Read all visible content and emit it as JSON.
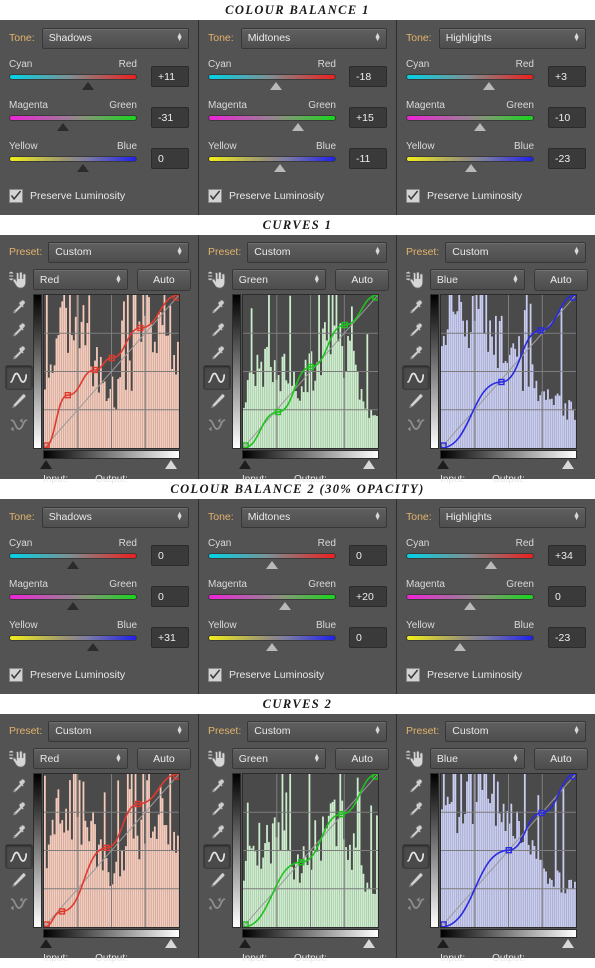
{
  "sections": [
    {
      "id": "colour-balance-1",
      "title": "COLOUR BALANCE 1",
      "type": "colour-balance",
      "panels": [
        {
          "tone_label": "Tone:",
          "tone_value": "Shadows",
          "thumb_style": "dark",
          "sliders": [
            {
              "left": "Cyan",
              "right": "Red",
              "value": "+11",
              "pos": 62
            },
            {
              "left": "Magenta",
              "right": "Green",
              "value": "-31",
              "pos": 42
            },
            {
              "left": "Yellow",
              "right": "Blue",
              "value": "0",
              "pos": 58
            }
          ],
          "preserve_label": "Preserve Luminosity",
          "preserve_checked": true
        },
        {
          "tone_label": "Tone:",
          "tone_value": "Midtones",
          "thumb_style": "light",
          "sliders": [
            {
              "left": "Cyan",
              "right": "Red",
              "value": "-18",
              "pos": 53
            },
            {
              "left": "Magenta",
              "right": "Green",
              "value": "+15",
              "pos": 71
            },
            {
              "left": "Yellow",
              "right": "Blue",
              "value": "-11",
              "pos": 56
            }
          ],
          "preserve_label": "Preserve Luminosity",
          "preserve_checked": true
        },
        {
          "tone_label": "Tone:",
          "tone_value": "Highlights",
          "thumb_style": "light",
          "sliders": [
            {
              "left": "Cyan",
              "right": "Red",
              "value": "+3",
              "pos": 65
            },
            {
              "left": "Magenta",
              "right": "Green",
              "value": "-10",
              "pos": 58
            },
            {
              "left": "Yellow",
              "right": "Blue",
              "value": "-23",
              "pos": 51
            }
          ],
          "preserve_label": "Preserve Luminosity",
          "preserve_checked": true
        }
      ]
    },
    {
      "id": "curves-1",
      "title": "CURVES 1",
      "type": "curves",
      "panels": [
        {
          "preset_label": "Preset:",
          "preset_value": "Custom",
          "channel": "Red",
          "auto_label": "Auto",
          "input_label": "Input:",
          "output_label": "Output:",
          "accent": "#e03a2f",
          "hist_fill": "#f6cbbb",
          "black_pos": 2,
          "white_pos": 93
        },
        {
          "preset_label": "Preset:",
          "preset_value": "Custom",
          "channel": "Green",
          "auto_label": "Auto",
          "input_label": "Input:",
          "output_label": "Output:",
          "accent": "#1fc21f",
          "hist_fill": "#cdeecd",
          "black_pos": 2,
          "white_pos": 93
        },
        {
          "preset_label": "Preset:",
          "preset_value": "Custom",
          "channel": "Blue",
          "auto_label": "Auto",
          "input_label": "Input:",
          "output_label": "Output:",
          "accent": "#2a2ae0",
          "hist_fill": "#c9cdf2",
          "black_pos": 2,
          "white_pos": 93
        }
      ]
    },
    {
      "id": "colour-balance-2",
      "title": "COLOUR BALANCE 2 (30% OPACITY)",
      "type": "colour-balance",
      "panels": [
        {
          "tone_label": "Tone:",
          "tone_value": "Shadows",
          "thumb_style": "dark",
          "sliders": [
            {
              "left": "Cyan",
              "right": "Red",
              "value": "0",
              "pos": 50
            },
            {
              "left": "Magenta",
              "right": "Green",
              "value": "0",
              "pos": 50
            },
            {
              "left": "Yellow",
              "right": "Blue",
              "value": "+31",
              "pos": 66
            }
          ],
          "preserve_label": "Preserve Luminosity",
          "preserve_checked": true
        },
        {
          "tone_label": "Tone:",
          "tone_value": "Midtones",
          "thumb_style": "light",
          "sliders": [
            {
              "left": "Cyan",
              "right": "Red",
              "value": "0",
              "pos": 50
            },
            {
              "left": "Magenta",
              "right": "Green",
              "value": "+20",
              "pos": 60
            },
            {
              "left": "Yellow",
              "right": "Blue",
              "value": "0",
              "pos": 50
            }
          ],
          "preserve_label": "Preserve Luminosity",
          "preserve_checked": true
        },
        {
          "tone_label": "Tone:",
          "tone_value": "Highlights",
          "thumb_style": "light",
          "sliders": [
            {
              "left": "Cyan",
              "right": "Red",
              "value": "+34",
              "pos": 67
            },
            {
              "left": "Magenta",
              "right": "Green",
              "value": "0",
              "pos": 50
            },
            {
              "left": "Yellow",
              "right": "Blue",
              "value": "-23",
              "pos": 42
            }
          ],
          "preserve_label": "Preserve Luminosity",
          "preserve_checked": true
        }
      ]
    },
    {
      "id": "curves-2",
      "title": "CURVES 2",
      "type": "curves",
      "panels": [
        {
          "preset_label": "Preset:",
          "preset_value": "Custom",
          "channel": "Red",
          "auto_label": "Auto",
          "input_label": "Input:",
          "output_label": "Output:",
          "accent": "#e03a2f",
          "hist_fill": "#f6cbbb",
          "black_pos": 2,
          "white_pos": 93
        },
        {
          "preset_label": "Preset:",
          "preset_value": "Custom",
          "channel": "Green",
          "auto_label": "Auto",
          "input_label": "Input:",
          "output_label": "Output:",
          "accent": "#1fc21f",
          "hist_fill": "#cdeecd",
          "black_pos": 2,
          "white_pos": 93
        },
        {
          "preset_label": "Preset:",
          "preset_value": "Custom",
          "channel": "Blue",
          "auto_label": "Auto",
          "input_label": "Input:",
          "output_label": "Output:",
          "accent": "#2a2ae0",
          "hist_fill": "#c9cdf2",
          "black_pos": 2,
          "white_pos": 93
        }
      ]
    }
  ],
  "chart_data": [
    {
      "type": "line",
      "title": "CURVES 1 - Red",
      "xlabel": "Input",
      "ylabel": "Output",
      "xlim": [
        0,
        255
      ],
      "ylim": [
        0,
        255
      ],
      "grid": true,
      "points": [
        [
          0,
          0
        ],
        [
          45,
          88
        ],
        [
          96,
          130
        ],
        [
          128,
          150
        ],
        [
          182,
          200
        ],
        [
          255,
          255
        ]
      ]
    },
    {
      "type": "line",
      "title": "CURVES 1 - Green",
      "xlabel": "Input",
      "ylabel": "Output",
      "xlim": [
        0,
        255
      ],
      "ylim": [
        0,
        255
      ],
      "grid": true,
      "points": [
        [
          0,
          0
        ],
        [
          66,
          60
        ],
        [
          128,
          135
        ],
        [
          192,
          205
        ],
        [
          255,
          255
        ]
      ]
    },
    {
      "type": "line",
      "title": "CURVES 1 - Blue",
      "xlabel": "Input",
      "ylabel": "Output",
      "xlim": [
        0,
        255
      ],
      "ylim": [
        0,
        255
      ],
      "grid": true,
      "points": [
        [
          0,
          0
        ],
        [
          114,
          110
        ],
        [
          188,
          196
        ],
        [
          255,
          255
        ]
      ]
    },
    {
      "type": "line",
      "title": "CURVES 2 - Red",
      "xlabel": "Input",
      "ylabel": "Output",
      "xlim": [
        0,
        255
      ],
      "ylim": [
        0,
        255
      ],
      "grid": true,
      "points": [
        [
          0,
          0
        ],
        [
          34,
          26
        ],
        [
          118,
          132
        ],
        [
          178,
          205
        ],
        [
          255,
          255
        ]
      ]
    },
    {
      "type": "line",
      "title": "CURVES 2 - Green",
      "xlabel": "Input",
      "ylabel": "Output",
      "xlim": [
        0,
        255
      ],
      "ylim": [
        0,
        255
      ],
      "grid": true,
      "points": [
        [
          0,
          0
        ],
        [
          110,
          108
        ],
        [
          186,
          188
        ],
        [
          255,
          255
        ]
      ]
    },
    {
      "type": "line",
      "title": "CURVES 2 - Blue",
      "xlabel": "Input",
      "ylabel": "Output",
      "xlim": [
        0,
        255
      ],
      "ylim": [
        0,
        255
      ],
      "grid": true,
      "points": [
        [
          0,
          0
        ],
        [
          128,
          128
        ],
        [
          190,
          190
        ],
        [
          255,
          255
        ]
      ]
    }
  ]
}
